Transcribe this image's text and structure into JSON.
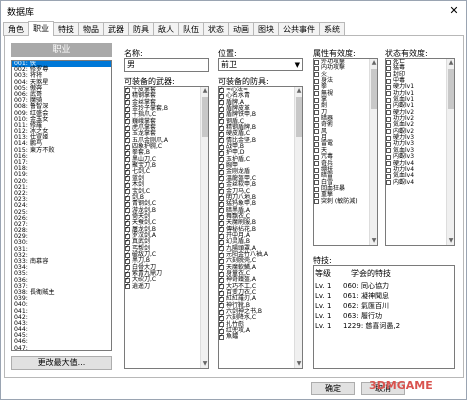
{
  "window": {
    "title": "数据库",
    "close": "✕"
  },
  "tabs": [
    "角色",
    "职业",
    "特技",
    "物品",
    "武器",
    "防具",
    "敌人",
    "队伍",
    "状态",
    "动画",
    "图块",
    "公共事件",
    "系统"
  ],
  "left": {
    "header": "职业",
    "jobs": [
      "001: 侠",
      "002: 修罗尊",
      "003: 将将",
      "004: 天煞星",
      "005: 傲奔",
      "006: 武哥",
      "007: 魔骑",
      "008: 鲁智深",
      "009: 红盛会",
      "010: 金玉女",
      "011: 修羅",
      "012: 冰之女",
      "013: 仕宣姬",
      "014: 鹏鸟",
      "015: 東方不败",
      "016:",
      "017:",
      "018:",
      "019:",
      "020:",
      "021:",
      "022:",
      "023:",
      "024:",
      "025:",
      "026:",
      "027:",
      "028:",
      "029:",
      "030:",
      "031:",
      "032:",
      "033: 南慕容",
      "034:",
      "035:",
      "036:",
      "037:",
      "038: 長衛賊主",
      "039:",
      "040:",
      "041:",
      "042:",
      "043:",
      "044:",
      "045:",
      "046:",
      "047:",
      "048: 測試用高手",
      "049:",
      "050:"
    ],
    "maxbtn": "更改最大值..."
  },
  "fields": {
    "name_label": "名称:",
    "name_value": "男",
    "pos_label": "位置:",
    "pos_value": "前卫",
    "weapon_label": "可装备的武器:",
    "armor_label": "可装备的防具:",
    "attr_label": "属性有效度:",
    "state_label": "状态有效度:",
    "skill_label": "特技:",
    "skill_col1": "等级",
    "skill_col2": "学会的特技"
  },
  "weapons": [
    "牛皮掌套",
    "精钢掌套",
    "金丝掌套",
    "金玲子掌套,B",
    "十指爪,C",
    "巍峨掌套",
    "虎爪掌套",
    "玉龙掌套",
    "五爪金刚爪,A",
    "四象护腕,C",
    "拳套,B",
    "黑山刀,C",
    "聚宝刀,B",
    "七剑,C",
    "蓝剑",
    "木剑",
    "宝剑,C",
    "剑,B",
    "青钢剑,C",
    "游龙剑,B",
    "倚天剑",
    "天蚕剑,C",
    "屠龙剑,B",
    "罗汉剑,A",
    "真武剑",
    "丐帮剑",
    "破敌刀,C",
    "黑刀,B",
    "白骨大刀",
    "紫青九鼎刀",
    "大砍刀,C",
    "逍遥刀"
  ],
  "armors": [
    "≈心法≈",
    "心名水青",
    "盾牌,A",
    "盾牌皮革",
    "盾牌铁甲,B",
    "钢盾,C",
    "精钢盾牌,B",
    "硬皮盾,C",
    "情比金坚,B",
    "战甲,B",
    "护甲,D",
    "玉护盾,C",
    "胸甲",
    "金刚龙盾",
    "溫龍盔甲,C",
    "金丝软甲,B",
    "金刀马,C",
    "明刀八地,B",
    "猛犸象甲,B",
    "暗黑盾,A",
    "舞飘衣,C",
    "天魔刷服,B",
    "傳秘拈花,B",
    "开中月,A",
    "幻灵盾,B",
    "九陽頭罩,A",
    "元阳金竹八袖,A",
    "六刻脱壳,C",
    "天魔軟鱗,A",
    "身童衣,C",
    "神奇鐵盔,A",
    "大巧不工,C",
    "百变刀衣,C",
    "紅紅羅刃,A",
    "神行靴,B",
    "六剑神之书,B",
    "六刻降水,C",
    "扎竹彪",
    "红兜攻,A",
    "魚鐺"
  ],
  "attrs": [
    "外功攻擊",
    "内功攻擊",
    "火",
    "身法",
    "拳",
    "無視",
    "掌",
    "劍",
    "刀",
    "暗器",
    "奇術",
    "风",
    "月",
    "雷電",
    "天",
    "咒毒",
    "奇兵",
    "绷扶",
    "暗雷",
    "白雪",
    "回血狂暴",
    "重撃",
    "突刺 (敏防減)"
  ],
  "states": [
    "死亡",
    "猛毒",
    "封印",
    "中毒",
    "硬力lv1",
    "功力lv1",
    "気血lv1",
    "内觀lv1",
    "硬力lv2",
    "功力lv2",
    "気血lv2",
    "内觀lv2",
    "硬力lv3",
    "功力lv3",
    "気血lv3",
    "内觀lv3",
    "硬力lv4",
    "功力lv4",
    "気血lv4",
    "内觀lv4"
  ],
  "skills": [
    [
      "Lv. 1",
      "060: 同心協力"
    ],
    [
      "Lv. 1",
      "061: 凝神聞息"
    ],
    [
      "Lv. 1",
      "062: 氣匯百川"
    ],
    [
      "Lv. 1",
      "063: 履行功"
    ],
    [
      "Lv. 1",
      "1229: 慈喜诃愚,2"
    ]
  ],
  "footer": {
    "ok": "确定",
    "cancel": "取消"
  },
  "watermark": "3DMGAME"
}
